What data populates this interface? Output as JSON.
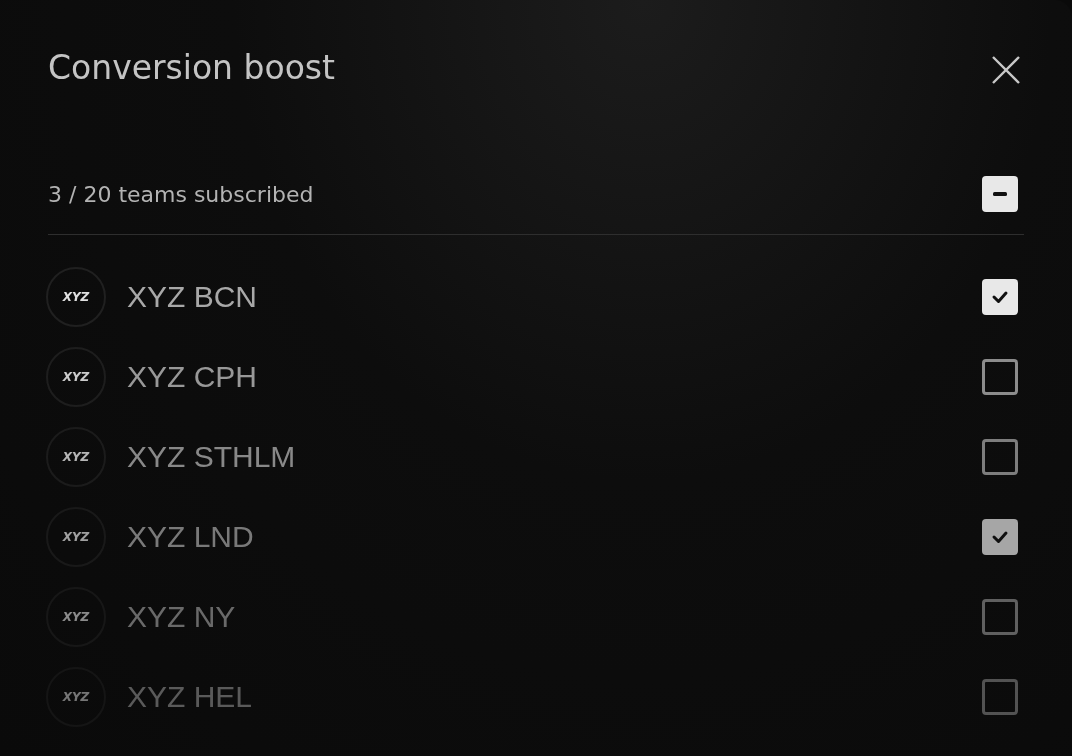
{
  "dialog": {
    "title": "Conversion boost",
    "summary": "3 / 20 teams subscribed",
    "select_all": {
      "indeterminate": true
    }
  },
  "teams": [
    {
      "logo": "XYZ",
      "name": "XYZ BCN",
      "checked": true
    },
    {
      "logo": "XYZ",
      "name": "XYZ CPH",
      "checked": false
    },
    {
      "logo": "XYZ",
      "name": "XYZ STHLM",
      "checked": false
    },
    {
      "logo": "XYZ",
      "name": "XYZ LND",
      "checked": true
    },
    {
      "logo": "XYZ",
      "name": "XYZ NY",
      "checked": false
    },
    {
      "logo": "XYZ",
      "name": "XYZ HEL",
      "checked": false
    }
  ]
}
